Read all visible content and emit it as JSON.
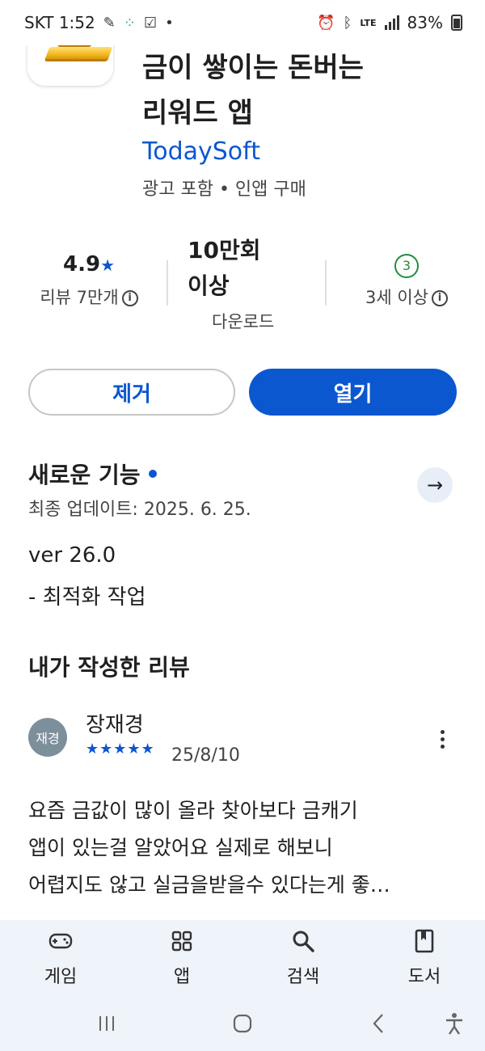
{
  "status_bar": {
    "carrier_time": "SKT 1:52",
    "network": "LTE",
    "battery": "83%"
  },
  "app": {
    "title_line_1": "금이 쌓이는 돈버는",
    "title_line_2": "리워드 앱",
    "developer": "TodaySoft",
    "tags": "광고 포함 • 인앱 구매"
  },
  "stats": {
    "rating": "4.9",
    "rating_star": "★",
    "reviews_label": "리뷰 7만개",
    "downloads_line_1": "10만회",
    "downloads_line_2": "이상",
    "downloads_label": "다운로드",
    "age_badge": "3",
    "age_label": "3세 이상",
    "info_glyph": "i"
  },
  "actions": {
    "remove_label": "제거",
    "open_label": "열기"
  },
  "whats_new": {
    "title": "새로운 기능",
    "arrow": "→",
    "updated": "최종 업데이트: 2025. 6. 25.",
    "version": "ver 26.0",
    "note": "- 최적화 작업"
  },
  "my_review": {
    "section_title": "내가 작성한 리뷰",
    "avatar_text": "재경",
    "reviewer": "장재경",
    "stars": "★★★★★",
    "rating": 5,
    "date": "25/8/10",
    "text_line_1": "요즘 금값이 많이 올라 찾아보다 금캐기",
    "text_line_2": "앱이 있는걸 알았어요 실제로 해보니",
    "text_line_3": "어렵지도 않고 실금을받을수 있다는게 좋…"
  },
  "bottom_nav": {
    "items": [
      {
        "label": "게임",
        "icon": "gamepad-icon"
      },
      {
        "label": "앱",
        "icon": "apps-grid-icon"
      },
      {
        "label": "검색",
        "icon": "search-icon"
      },
      {
        "label": "도서",
        "icon": "book-icon"
      }
    ]
  },
  "colors": {
    "accent": "#0b57d0",
    "age_green": "#1e8e3e",
    "nav_bg": "#eff3fa"
  }
}
